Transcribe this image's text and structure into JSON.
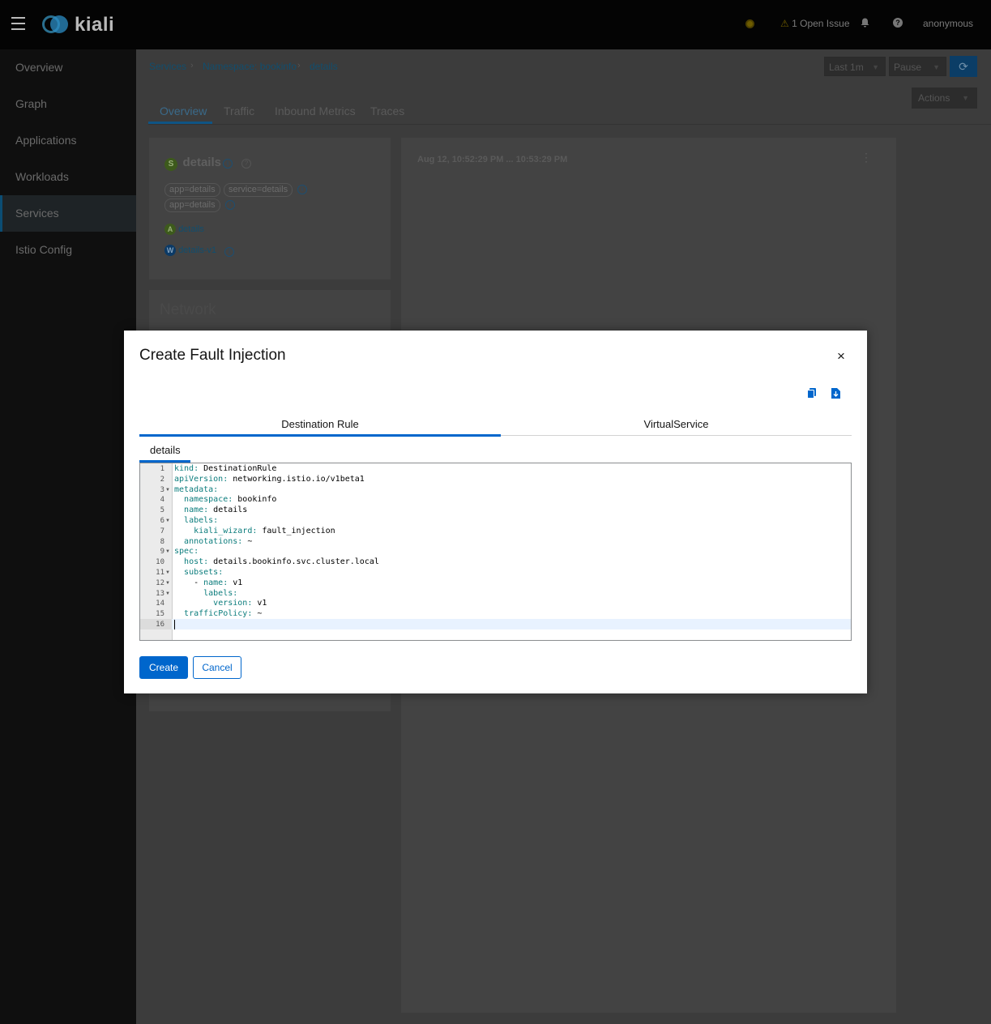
{
  "app": {
    "name": "kiali"
  },
  "header": {
    "open_issues": "1 Open Issue",
    "user": "anonymous"
  },
  "sidebar": {
    "items": [
      {
        "label": "Overview"
      },
      {
        "label": "Graph"
      },
      {
        "label": "Applications"
      },
      {
        "label": "Workloads"
      },
      {
        "label": "Services",
        "active": true
      },
      {
        "label": "Istio Config"
      }
    ]
  },
  "breadcrumb": {
    "items": [
      "Services",
      "Namespace: bookinfo",
      "details"
    ]
  },
  "toolbar": {
    "interval": "Last 1m",
    "refresh": "Pause",
    "actions": "Actions"
  },
  "tabs": [
    "Overview",
    "Traffic",
    "Inbound Metrics",
    "Traces"
  ],
  "service_card": {
    "badge": "S",
    "name": "details",
    "labels": [
      "app=details",
      "service=details"
    ],
    "selector": "app=details",
    "app_badge": "A",
    "app": "details",
    "workload_badge": "W",
    "workload": "details-v1"
  },
  "network_card": {
    "title": "Network"
  },
  "graph_card": {
    "time_range": "Aug 12, 10:52:29 PM ... 10:53:29 PM"
  },
  "modal": {
    "title": "Create Fault Injection",
    "close": "×",
    "tabs": [
      "Destination Rule",
      "VirtualService"
    ],
    "subtab": "details",
    "editor_lines": [
      {
        "n": "1",
        "key": "kind",
        "val": "DestinationRule",
        "indent": "",
        "fold": false
      },
      {
        "n": "2",
        "key": "apiVersion",
        "val": "networking.istio.io/v1beta1",
        "indent": "",
        "fold": false
      },
      {
        "n": "3",
        "key": "metadata",
        "val": "",
        "indent": "",
        "fold": true
      },
      {
        "n": "4",
        "key": "namespace",
        "val": "bookinfo",
        "indent": "  ",
        "fold": false
      },
      {
        "n": "5",
        "key": "name",
        "val": "details",
        "indent": "  ",
        "fold": false
      },
      {
        "n": "6",
        "key": "labels",
        "val": "",
        "indent": "  ",
        "fold": true
      },
      {
        "n": "7",
        "key": "kiali_wizard",
        "val": "fault_injection",
        "indent": "    ",
        "fold": false
      },
      {
        "n": "8",
        "key": "annotations",
        "val": "~",
        "indent": "  ",
        "fold": false
      },
      {
        "n": "9",
        "key": "spec",
        "val": "",
        "indent": "",
        "fold": true
      },
      {
        "n": "10",
        "key": "host",
        "val": "details.bookinfo.svc.cluster.local",
        "indent": "  ",
        "fold": false
      },
      {
        "n": "11",
        "key": "subsets",
        "val": "",
        "indent": "  ",
        "fold": true
      },
      {
        "n": "12",
        "key": "name",
        "val": "v1",
        "indent": "    - ",
        "fold": true
      },
      {
        "n": "13",
        "key": "labels",
        "val": "",
        "indent": "      ",
        "fold": true
      },
      {
        "n": "14",
        "key": "version",
        "val": "v1",
        "indent": "        ",
        "fold": false
      },
      {
        "n": "15",
        "key": "trafficPolicy",
        "val": "~",
        "indent": "  ",
        "fold": false
      },
      {
        "n": "16",
        "key": "",
        "val": "",
        "indent": "",
        "fold": false
      }
    ],
    "create_label": "Create",
    "cancel_label": "Cancel"
  },
  "colors": {
    "primary": "#0066cc",
    "topbar": "#040404",
    "sidebar": "#0f0f0f",
    "yaml_key": "#0c7d7d"
  }
}
